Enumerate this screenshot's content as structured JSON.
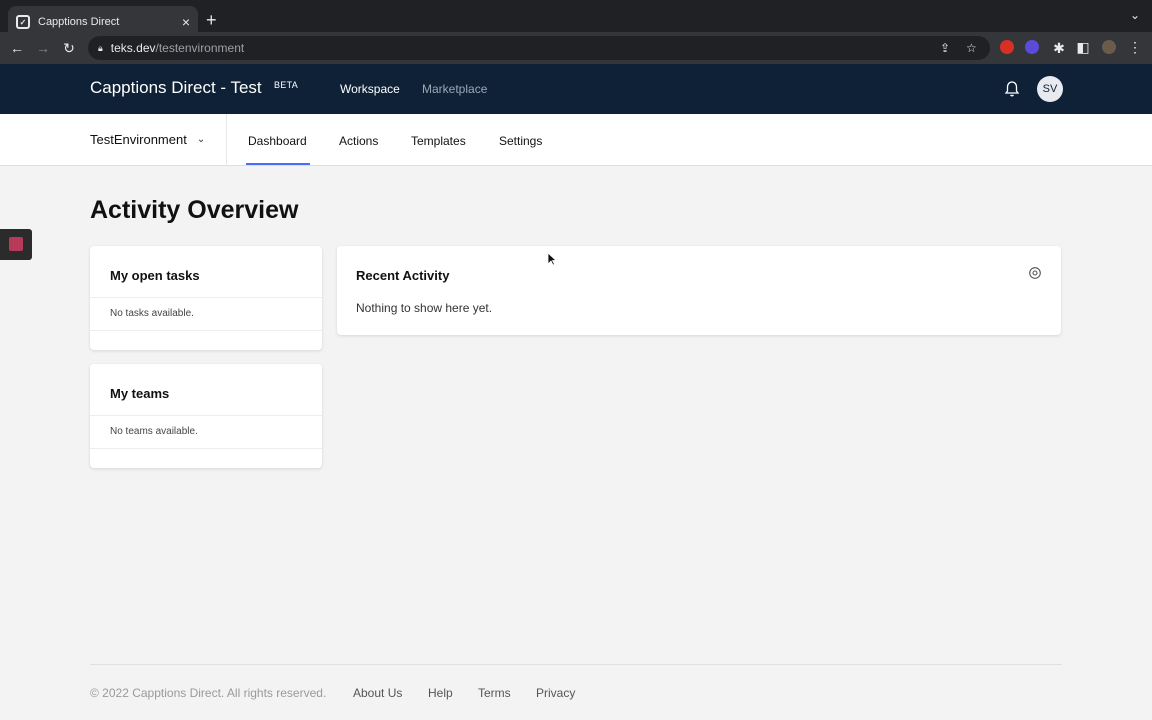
{
  "browser": {
    "tab_title": "Capptions Direct",
    "url_host": "teks.dev",
    "url_path": "/testenvironment"
  },
  "header": {
    "brand": "Capptions Direct - Test",
    "badge": "BETA",
    "nav": [
      "Workspace",
      "Marketplace"
    ],
    "avatar_initials": "SV"
  },
  "subnav": {
    "environment": "TestEnvironment",
    "tabs": [
      "Dashboard",
      "Actions",
      "Templates",
      "Settings"
    ],
    "active_tab": "Dashboard"
  },
  "main": {
    "title": "Activity Overview",
    "open_tasks": {
      "title": "My open tasks",
      "empty": "No tasks available."
    },
    "teams": {
      "title": "My teams",
      "empty": "No teams available."
    },
    "recent_activity": {
      "title": "Recent Activity",
      "empty": "Nothing to show here yet."
    }
  },
  "footer": {
    "copyright": "© 2022 Capptions Direct. All rights reserved.",
    "links": [
      "About Us",
      "Help",
      "Terms",
      "Privacy"
    ]
  },
  "colors": {
    "header_bg": "#0f2137",
    "accent": "#4a6cf7"
  }
}
